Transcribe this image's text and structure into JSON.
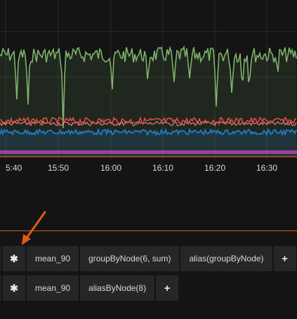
{
  "graph": {
    "x_ticks": [
      "5:40",
      "15:50",
      "16:00",
      "16:10",
      "16:20",
      "16:30"
    ],
    "colors": {
      "green": "#7eb26d",
      "red": "#e24d42",
      "blue": "#1f78c1",
      "purple": "#ba43a9",
      "pink": "#f29191",
      "orange_accent": "#e05a1a"
    }
  },
  "queries": {
    "row1": {
      "star": "✱",
      "metric": "mean_90",
      "fn1": "groupByNode(6, sum)",
      "fn2": "alias(groupByNode)",
      "add": "+"
    },
    "row2": {
      "star": "✱",
      "metric": "mean_90",
      "fn1": "aliasByNode(8)",
      "add": "+"
    }
  },
  "annotation": {
    "icon": "arrow-icon",
    "color": "#e05a1a"
  }
}
